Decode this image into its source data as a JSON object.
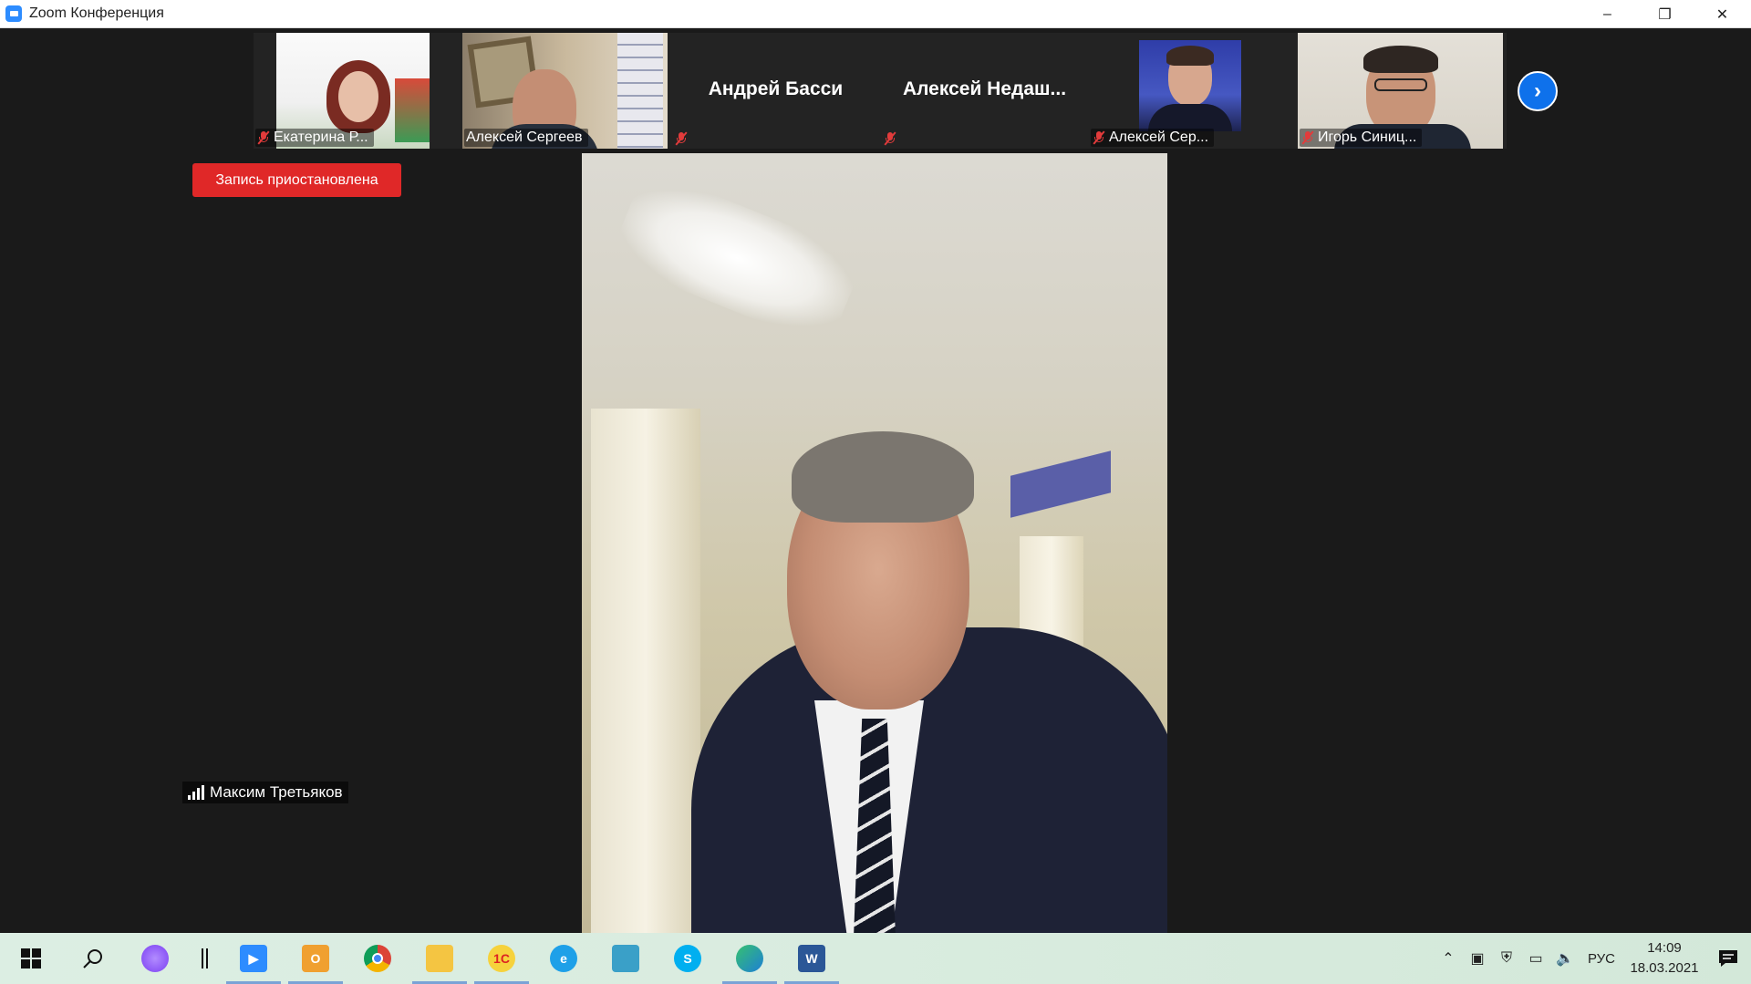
{
  "window": {
    "title": "Zoom Конференция",
    "minimize": "–",
    "restore": "❐",
    "close": "✕"
  },
  "participants": [
    {
      "name": "Екатерина Р...",
      "muted": true,
      "video": true
    },
    {
      "name": "Алексей Сергеев",
      "muted": false,
      "video": true
    },
    {
      "name": "Андрей Басси",
      "muted": true,
      "video": false
    },
    {
      "name": "Алексей  Недаш...",
      "muted": true,
      "video": false
    },
    {
      "name": "Алексей Сер...",
      "muted": true,
      "video": true
    },
    {
      "name": "Игорь Синиц...",
      "muted": true,
      "video": true
    }
  ],
  "next_icon": "›",
  "recording": {
    "label": "Запись приостановлена"
  },
  "speaker": {
    "name": "Максим Третьяков"
  },
  "taskbar": {
    "apps": [
      {
        "name": "start-icon"
      },
      {
        "name": "search-icon"
      },
      {
        "name": "cortana-icon"
      },
      {
        "name": "task-view-icon"
      },
      {
        "name": "zoom-icon",
        "active": true
      },
      {
        "name": "outlook-icon",
        "active": true
      },
      {
        "name": "chrome-icon"
      },
      {
        "name": "file-explorer-icon",
        "active": true
      },
      {
        "name": "1c-icon",
        "active": true
      },
      {
        "name": "internet-explorer-icon"
      },
      {
        "name": "app-icon"
      },
      {
        "name": "skype-icon"
      },
      {
        "name": "edge-icon",
        "active": true
      },
      {
        "name": "word-icon",
        "active": true
      }
    ],
    "tray": {
      "language": "РУС",
      "time": "14:09",
      "date": "18.03.2021"
    }
  }
}
